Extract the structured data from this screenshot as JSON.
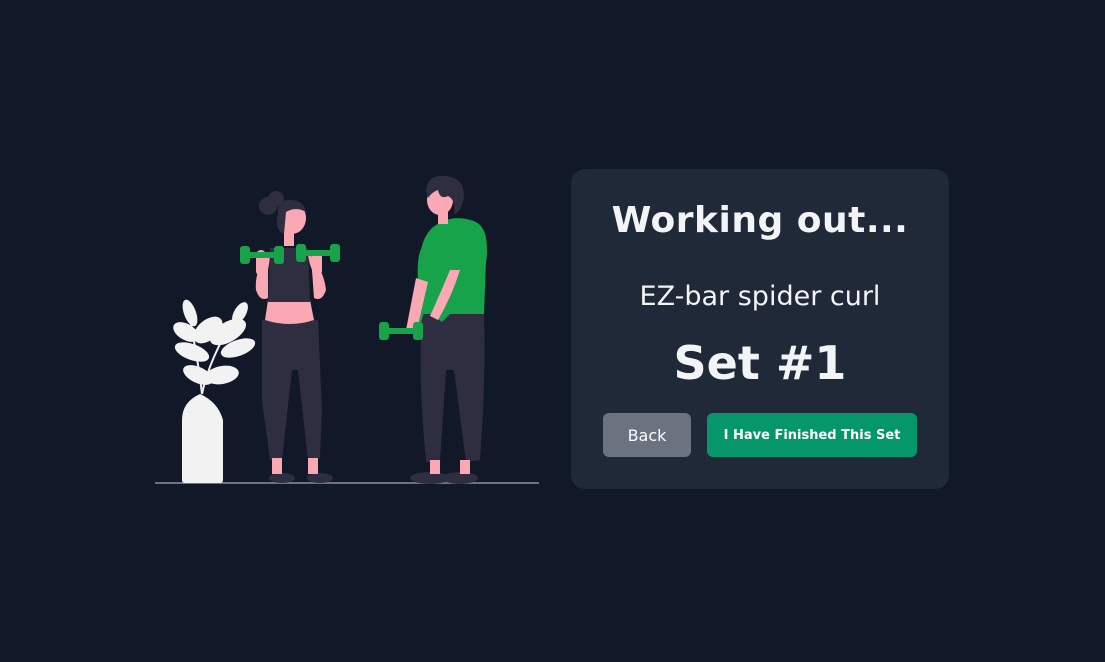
{
  "workout": {
    "title": "Working out...",
    "exercise_name": "EZ-bar spider curl",
    "set_label": "Set #1"
  },
  "buttons": {
    "back_label": "Back",
    "finish_label": "I Have Finished This Set"
  },
  "colors": {
    "background": "#111827",
    "card": "#1f2937",
    "back_button": "#6b7280",
    "finish_button": "#059669",
    "accent_green": "#16a34a",
    "skin": "#f9a8b4",
    "dark_clothing": "#2f2e41"
  },
  "illustration": {
    "name": "people-exercising-illustration"
  }
}
